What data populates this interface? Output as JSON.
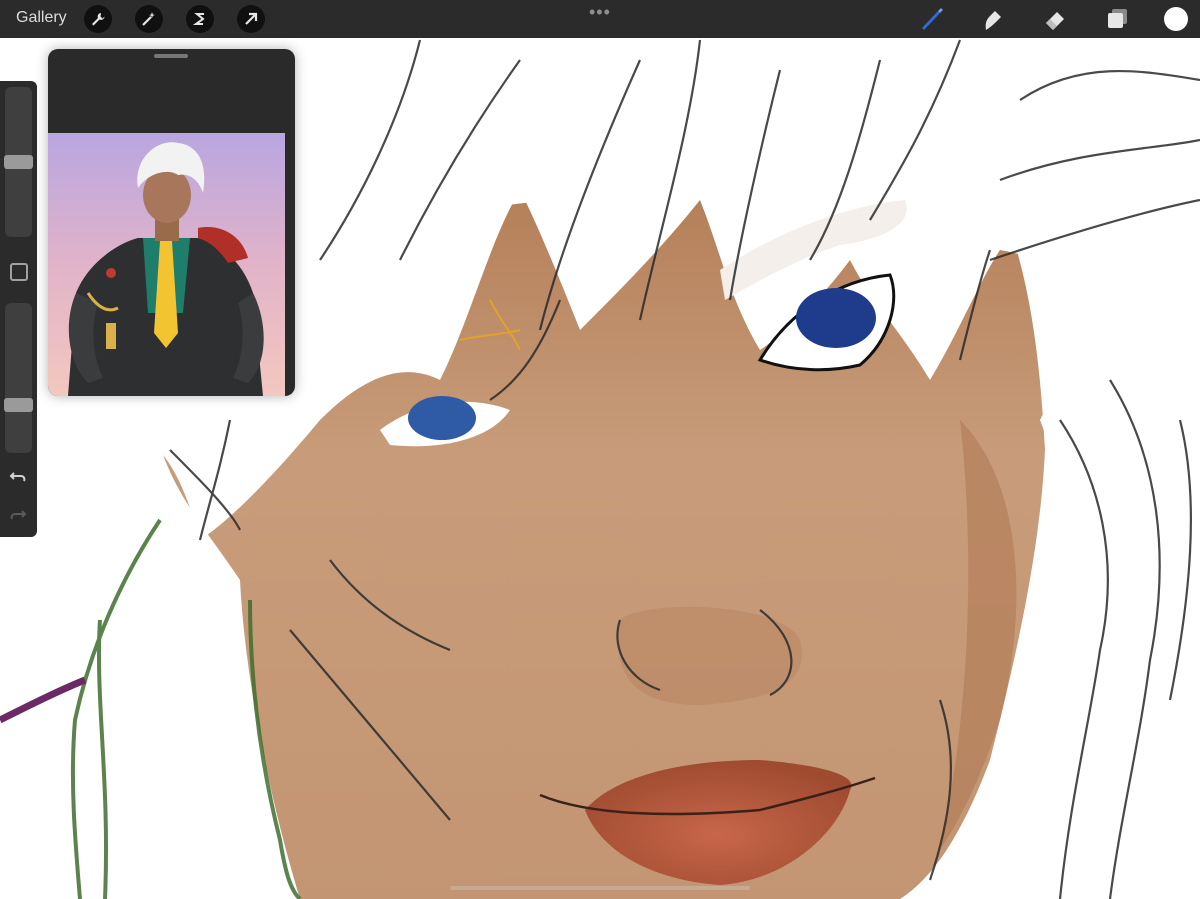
{
  "toolbar": {
    "gallery_label": "Gallery",
    "more_label": "•••",
    "left_tools": [
      "wrench-icon",
      "magic-wand-icon",
      "selection-icon",
      "transform-arrow-icon"
    ],
    "right_tools": [
      "brush-icon",
      "smudge-icon",
      "eraser-icon",
      "layers-icon"
    ],
    "brush_color": "#2f6bd6",
    "current_color": "#ffffff"
  },
  "sidebar": {
    "brush_size_level": 0.5,
    "opacity_level": 0.3
  },
  "colors": {
    "skin": "#c89a78",
    "skin_shadow": "#b5805b",
    "hair": "#ffffff",
    "iris_left": "#2f5aa6",
    "iris_right": "#1f3c8c",
    "lips": "#b2593c",
    "sketch": "#2a2a2a",
    "ui_bg": "#2b2b2b"
  }
}
